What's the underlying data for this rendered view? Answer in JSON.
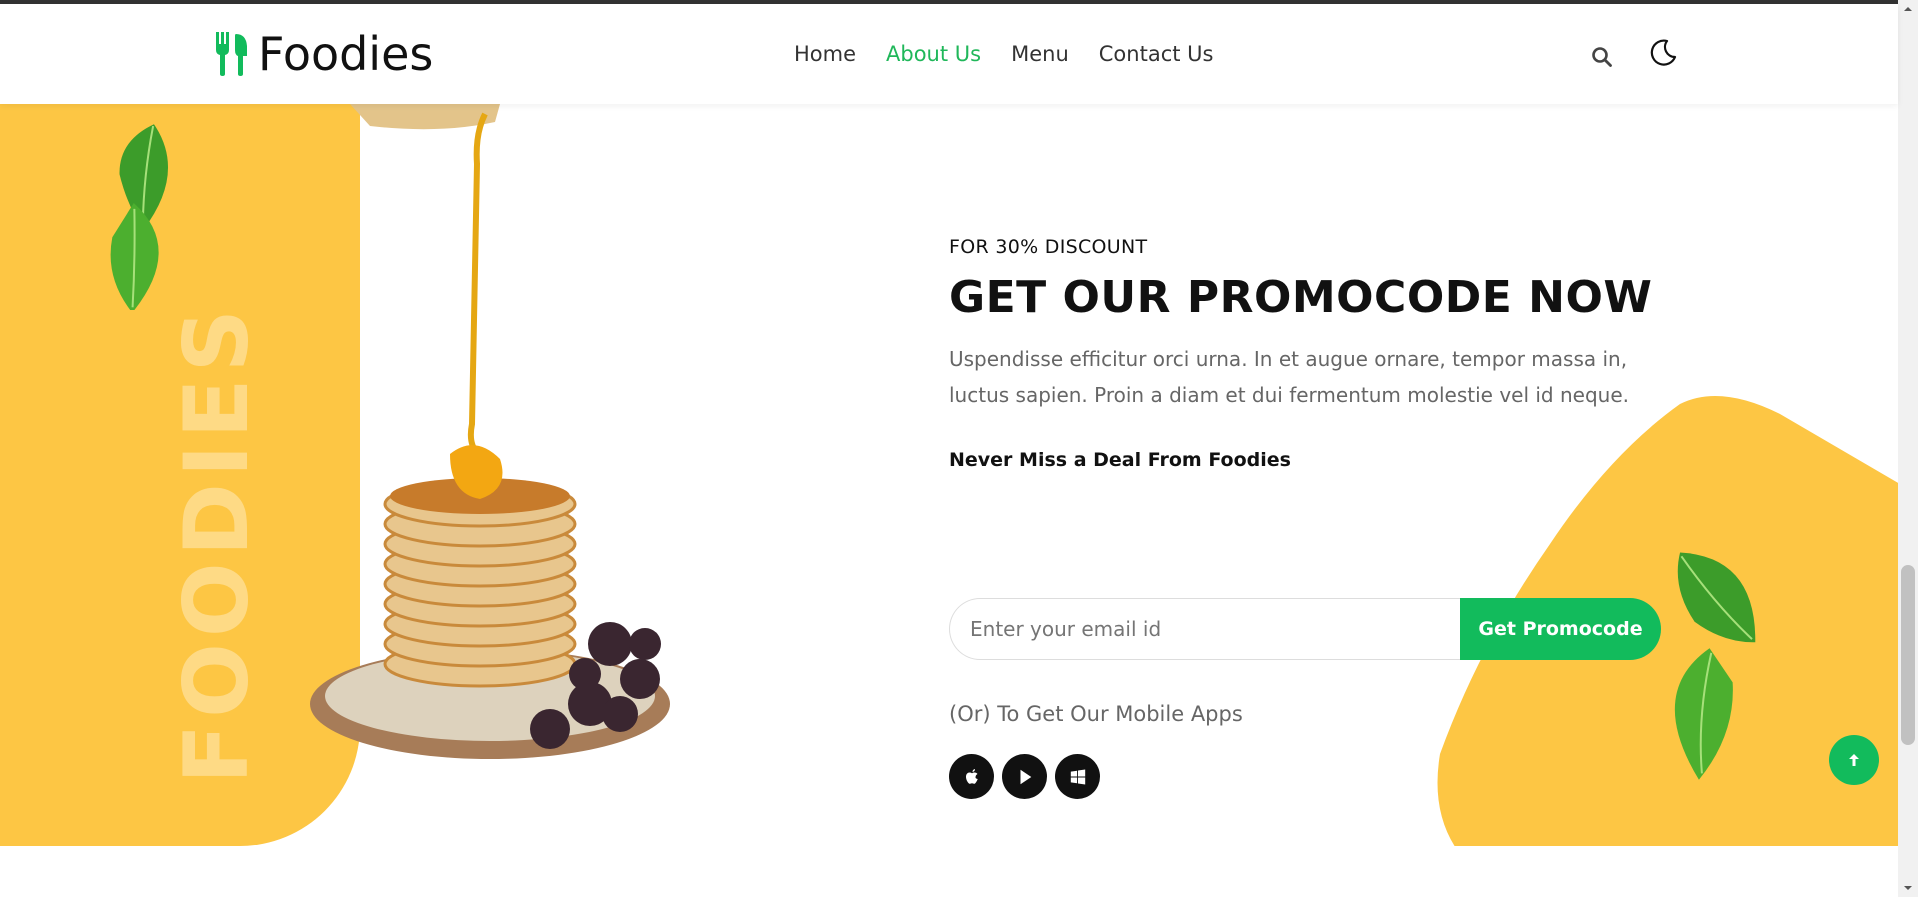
{
  "header": {
    "logo_text": "Foodies",
    "nav": [
      {
        "label": "Home",
        "active": false
      },
      {
        "label": "About Us",
        "active": true
      },
      {
        "label": "Menu",
        "active": false
      },
      {
        "label": "Contact Us",
        "active": false
      }
    ],
    "icons": [
      "search-icon",
      "moon-icon"
    ]
  },
  "hero": {
    "side_word": "FOODIES"
  },
  "promo": {
    "subtitle": "FOR 30% DISCOUNT",
    "title": "GET OUR PROMOCODE NOW",
    "description": "Uspendisse efficitur orci urna. In et augue ornare, tempor massa in, luctus sapien. Proin a diam et dui fermentum molestie vel id neque.",
    "deal_label": "Never Miss a Deal From Foodies",
    "email_placeholder": "Enter your email id",
    "button_label": "Get Promocode",
    "apps_label": "(Or) To Get Our Mobile Apps",
    "app_icons": [
      "apple-icon",
      "play-store-icon",
      "windows-icon"
    ]
  },
  "colors": {
    "accent": "#12bb5c",
    "yellow": "#fdc644",
    "dark": "#111111"
  }
}
